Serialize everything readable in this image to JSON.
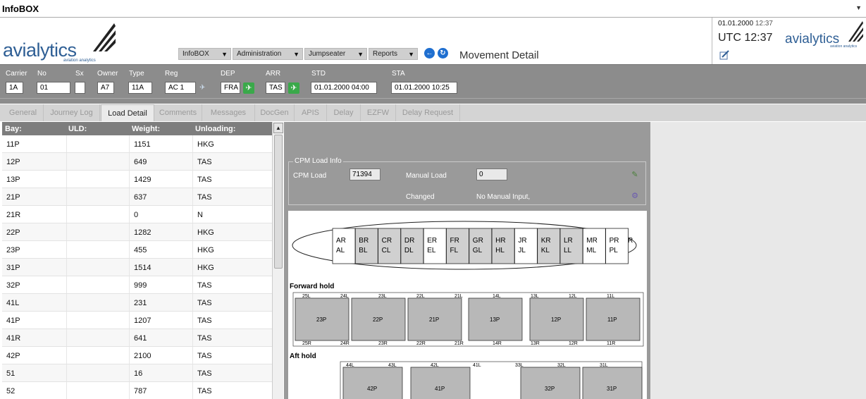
{
  "window": {
    "title": "InfoBOX"
  },
  "header": {
    "logo_text": "avialytics",
    "logo_sub": "aviation analytics",
    "menus": [
      {
        "label": "InfoBOX"
      },
      {
        "label": "Administration"
      },
      {
        "label": "Jumpseater"
      },
      {
        "label": "Reports"
      }
    ],
    "page_title": "Movement Detail",
    "date": "01.01.2000",
    "time": "12:37",
    "utc": "UTC 12:37"
  },
  "flight": {
    "carrier_label": "Carrier",
    "carrier": "1A",
    "no_label": "No",
    "no": "01",
    "sx_label": "Sx",
    "sx": "",
    "owner_label": "Owner",
    "owner": "A7",
    "type_label": "Type",
    "type": "11A",
    "reg_label": "Reg",
    "reg": "AC 1",
    "dep_label": "DEP",
    "dep": "FRA",
    "arr_label": "ARR",
    "arr": "TAS",
    "std_label": "STD",
    "std": "01.01.2000 04:00",
    "sta_label": "STA",
    "sta": "01.01.2000 10:25"
  },
  "tabs": [
    {
      "label": "General"
    },
    {
      "label": "Journey Log"
    },
    {
      "label": "Load Detail"
    },
    {
      "label": "Comments"
    },
    {
      "label": "Messages"
    },
    {
      "label": "DocGen"
    },
    {
      "label": "APIS"
    },
    {
      "label": "Delay"
    },
    {
      "label": "EZFW"
    },
    {
      "label": "Delay Request"
    }
  ],
  "active_tab": "Load Detail",
  "table": {
    "headers": [
      "Bay:",
      "ULD:",
      "Weight:",
      "Unloading:"
    ],
    "rows": [
      [
        "11P",
        "",
        "1151",
        "HKG"
      ],
      [
        "12P",
        "",
        "649",
        "TAS"
      ],
      [
        "13P",
        "",
        "1429",
        "TAS"
      ],
      [
        "21P",
        "",
        "637",
        "TAS"
      ],
      [
        "21R",
        "",
        "0",
        "N"
      ],
      [
        "22P",
        "",
        "1282",
        "HKG"
      ],
      [
        "23P",
        "",
        "455",
        "HKG"
      ],
      [
        "31P",
        "",
        "1514",
        "HKG"
      ],
      [
        "32P",
        "",
        "999",
        "TAS"
      ],
      [
        "41L",
        "",
        "231",
        "TAS"
      ],
      [
        "41P",
        "",
        "1207",
        "TAS"
      ],
      [
        "41R",
        "",
        "641",
        "TAS"
      ],
      [
        "42P",
        "",
        "2100",
        "TAS"
      ],
      [
        "51",
        "",
        "16",
        "TAS"
      ],
      [
        "52",
        "",
        "787",
        "TAS"
      ]
    ]
  },
  "cpm": {
    "legend": "CPM Load Info",
    "cpm_load_label": "CPM Load",
    "cpm_load": "71394",
    "manual_load_label": "Manual Load",
    "manual_load": "0",
    "changed_label": "Changed",
    "changed_value": "No Manual Input,"
  },
  "diagram": {
    "upper_top": [
      "AR",
      "BR",
      "CR",
      "DR",
      "ER",
      "FR",
      "GR",
      "HR",
      "JR",
      "KR",
      "LR",
      "MR",
      "PR",
      "R"
    ],
    "upper_bottom": [
      "AL",
      "BL",
      "CL",
      "DL",
      "EL",
      "FL",
      "GL",
      "HL",
      "JL",
      "KL",
      "LL",
      "ML",
      "PL"
    ],
    "forward_label": "Forward hold",
    "forward_top": [
      "25L",
      "24L",
      "23L",
      "22L",
      "21L",
      "14L",
      "13L",
      "12L",
      "11L"
    ],
    "forward_pallets": [
      "23P",
      "22P",
      "21P",
      "13P",
      "12P",
      "11P"
    ],
    "forward_bottom": [
      "25R",
      "24R",
      "23R",
      "22R",
      "21R",
      "14R",
      "13R",
      "12R",
      "11R"
    ],
    "aft_label": "Aft hold",
    "aft_top": [
      "44L",
      "43L",
      "42L",
      "41L",
      "33L",
      "32L",
      "31L"
    ],
    "aft_pallets": [
      "42P",
      "41P",
      "32P",
      "31P"
    ]
  }
}
